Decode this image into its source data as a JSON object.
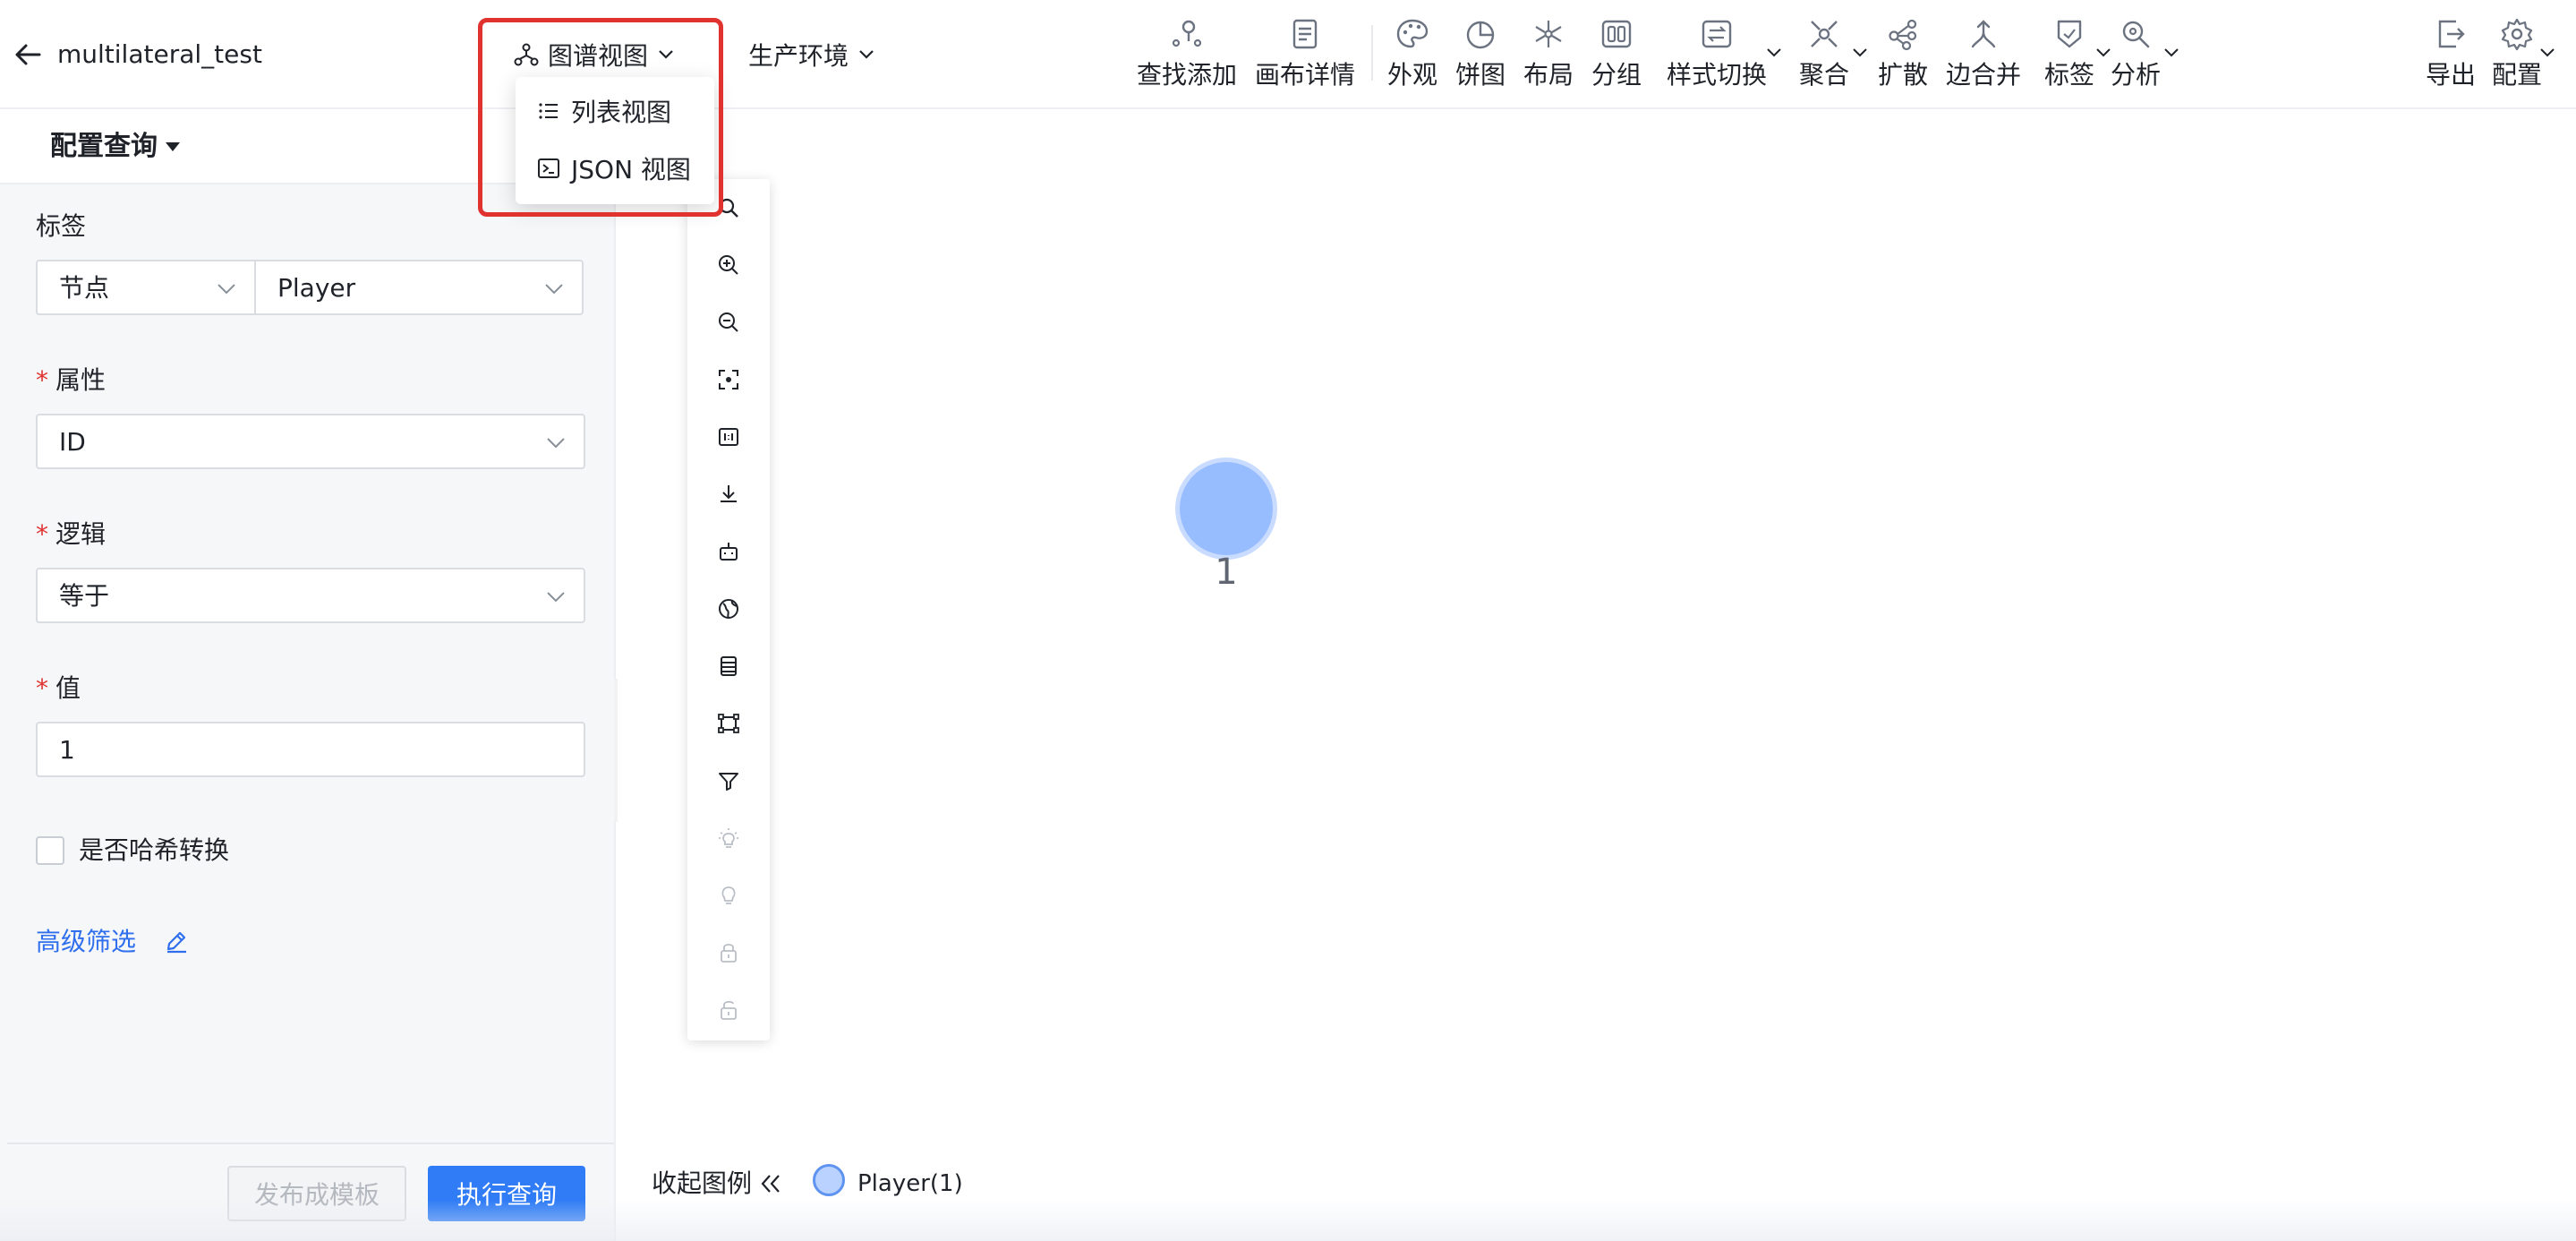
{
  "header": {
    "title": "multilateral_test",
    "view_switcher": {
      "label": "图谱视图",
      "icon": "graph-icon"
    },
    "environment": {
      "label": "生产环境"
    },
    "tools": [
      {
        "label": "查找添加",
        "icon": "find-add-icon"
      },
      {
        "label": "画布详情",
        "icon": "canvas-detail-icon"
      },
      {
        "label": "外观",
        "icon": "palette-icon"
      },
      {
        "label": "饼图",
        "icon": "pie-chart-icon"
      },
      {
        "label": "布局",
        "icon": "layout-icon"
      },
      {
        "label": "分组",
        "icon": "group-icon"
      },
      {
        "label": "样式切换",
        "icon": "style-switch-icon"
      },
      {
        "label": "聚合",
        "icon": "aggregate-icon"
      },
      {
        "label": "扩散",
        "icon": "expand-icon"
      },
      {
        "label": "边合并",
        "icon": "edge-merge-icon"
      },
      {
        "label": "标签",
        "icon": "tag-icon"
      },
      {
        "label": "分析",
        "icon": "analysis-icon"
      },
      {
        "label": "导出",
        "icon": "export-icon"
      },
      {
        "label": "配置",
        "icon": "settings-icon"
      }
    ]
  },
  "view_menu": {
    "items": [
      {
        "label": "列表视图",
        "icon": "list-icon"
      },
      {
        "label": "JSON 视图",
        "icon": "terminal-icon"
      }
    ]
  },
  "query_panel": {
    "title": "配置查询",
    "label_field": {
      "label": "标签",
      "type_value": "节点",
      "label_value": "Player"
    },
    "property_field": {
      "label": "属性",
      "value": "ID"
    },
    "logic_field": {
      "label": "逻辑",
      "value": "等于"
    },
    "value_field": {
      "label": "值",
      "value": "1"
    },
    "hash_checkbox": {
      "label": "是否哈希转换",
      "checked": false
    },
    "advanced_filter": {
      "label": "高级筛选"
    },
    "publish_button": "发布成模板",
    "run_button": "执行查询",
    "required_mark": "*"
  },
  "canvas_toolbar": {
    "tools": [
      "search-icon",
      "zoom-in-icon",
      "zoom-out-icon",
      "fit-view-icon",
      "actual-size-icon",
      "download-icon",
      "robot-icon",
      "globe-icon",
      "list-panel-icon",
      "select-box-icon",
      "filter-icon",
      "bulb-on-icon",
      "bulb-off-icon",
      "lock-icon",
      "unlock-icon"
    ]
  },
  "graph": {
    "nodes": [
      {
        "label": "1",
        "color": "#98bdff"
      }
    ]
  },
  "legend": {
    "toggle_label": "收起图例",
    "items": [
      {
        "label": "Player(1)",
        "color": "#b9d2ff"
      }
    ]
  },
  "colors": {
    "accent": "#2f7cf6",
    "link": "#2f6fed",
    "highlight": "#e0332f",
    "required": "#e0332f"
  }
}
